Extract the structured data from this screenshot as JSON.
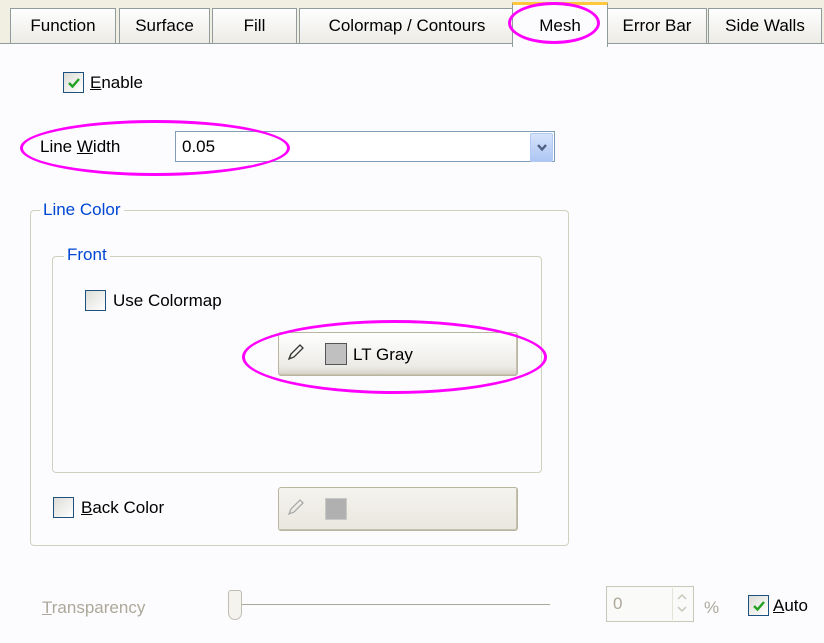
{
  "tabs": [
    {
      "label": "Function"
    },
    {
      "label": "Surface"
    },
    {
      "label": "Fill"
    },
    {
      "label": "Colormap / Contours"
    },
    {
      "label": "Mesh"
    },
    {
      "label": "Error Bar"
    },
    {
      "label": "Side Walls"
    }
  ],
  "active_tab": "Mesh",
  "enable": {
    "pre": "",
    "key": "E",
    "post": "nable",
    "checked": true
  },
  "line_width": {
    "pre": "Line ",
    "key": "W",
    "post": "idth",
    "value": "0.05"
  },
  "line_color": {
    "label": "Line Color",
    "front": {
      "label": "Front",
      "use_colormap": {
        "label": "Use Colormap",
        "checked": false
      },
      "color_button": {
        "label": "LT Gray",
        "swatch": "#c0c0c0"
      }
    },
    "back_color": {
      "key": "B",
      "post": "ack Color",
      "checked": false,
      "swatch": "#b0b0b0"
    }
  },
  "transparency": {
    "pre": "",
    "key": "T",
    "post": "ransparency",
    "value": "0",
    "unit": "%",
    "level_percent": 0
  },
  "auto": {
    "key": "A",
    "post": "uto",
    "checked": true
  },
  "colors": {
    "highlight": "#ff00ff",
    "tab_accent": "#ffc83c",
    "group_title": "#0046d5"
  }
}
